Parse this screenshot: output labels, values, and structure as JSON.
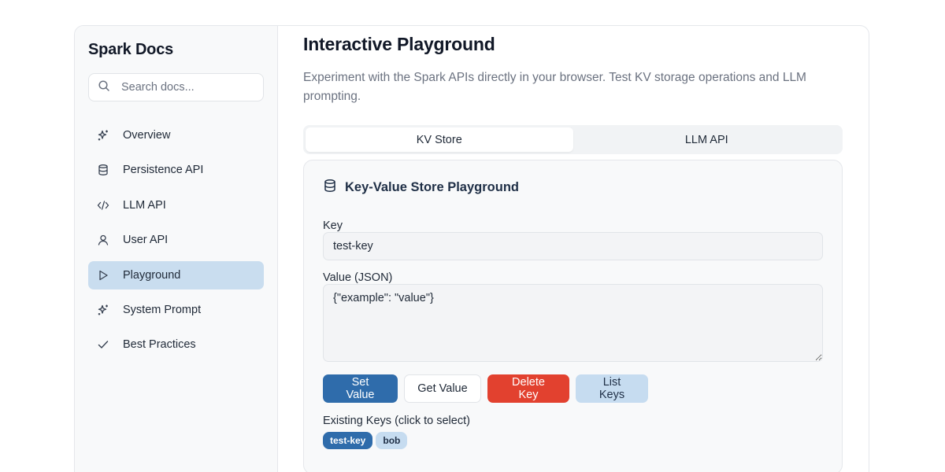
{
  "sidebar": {
    "brand": "Spark Docs",
    "search_placeholder": "Search docs...",
    "items": [
      {
        "label": "Overview",
        "icon": "sparkles-icon"
      },
      {
        "label": "Persistence API",
        "icon": "database-icon"
      },
      {
        "label": "LLM API",
        "icon": "code-icon"
      },
      {
        "label": "User API",
        "icon": "user-icon"
      },
      {
        "label": "Playground",
        "icon": "play-icon",
        "active": true
      },
      {
        "label": "System Prompt",
        "icon": "sparkles-icon"
      },
      {
        "label": "Best Practices",
        "icon": "check-icon"
      }
    ]
  },
  "main": {
    "title": "Interactive Playground",
    "description": "Experiment with the Spark APIs directly in your browser. Test KV storage operations and LLM prompting.",
    "tabs": [
      {
        "label": "KV Store",
        "active": true
      },
      {
        "label": "LLM API",
        "active": false
      }
    ],
    "card": {
      "title": "Key-Value Store Playground",
      "key_label": "Key",
      "key_value": "test-key",
      "value_label": "Value (JSON)",
      "value_text": "{\"example\": \"value\"}",
      "buttons": {
        "set": "Set Value",
        "get": "Get Value",
        "delete": "Delete Key",
        "list": "List Keys"
      },
      "existing_label": "Existing Keys (click to select)",
      "keys": [
        {
          "label": "test-key",
          "selected": true
        },
        {
          "label": "bob",
          "selected": false
        }
      ]
    }
  },
  "colors": {
    "accent": "#2f6cab",
    "active_nav_bg": "#c9ddef",
    "danger": "#e2412f",
    "soft": "#c6dcf0"
  }
}
